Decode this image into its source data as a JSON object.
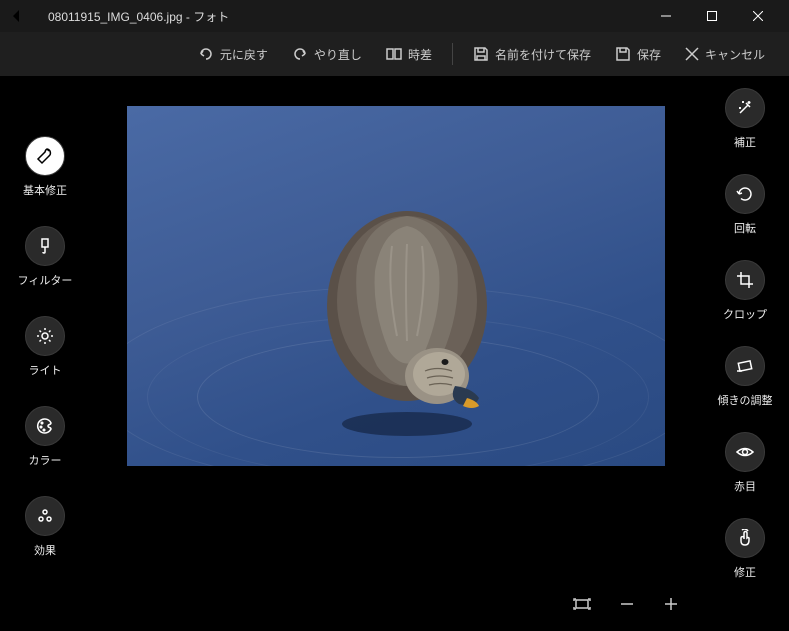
{
  "titlebar": {
    "filename": "08011915_IMG_0406.jpg",
    "appname": "フォト"
  },
  "toolbar": {
    "undo": "元に戻す",
    "redo": "やり直し",
    "compare": "時差",
    "save_as": "名前を付けて保存",
    "save": "保存",
    "cancel": "キャンセル"
  },
  "leftrail": {
    "basic": "基本修正",
    "filter": "フィルター",
    "light": "ライト",
    "color": "カラー",
    "effect": "効果"
  },
  "rightrail": {
    "enhance": "補正",
    "rotate": "回転",
    "crop": "クロップ",
    "straighten": "傾きの調整",
    "redeye": "赤目",
    "retouch": "修正"
  }
}
